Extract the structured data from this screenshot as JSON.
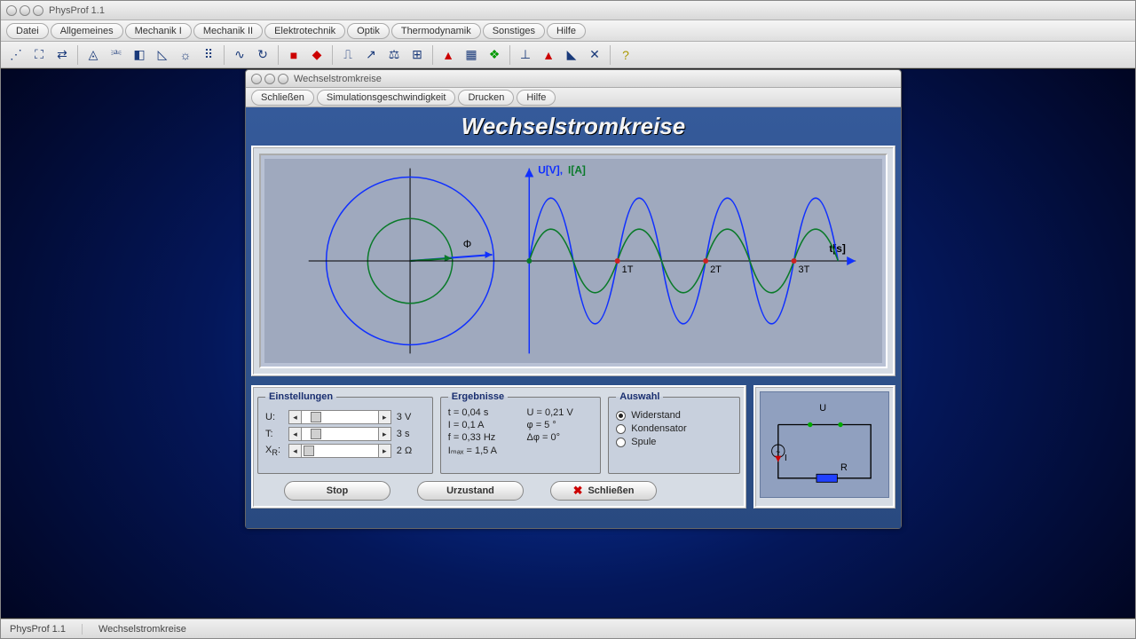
{
  "app": {
    "title": "PhysProf 1.1"
  },
  "menu": [
    "Datei",
    "Allgemeines",
    "Mechanik I",
    "Mechanik II",
    "Elektrotechnik",
    "Optik",
    "Thermodynamik",
    "Sonstiges",
    "Hilfe"
  ],
  "status": {
    "app": "PhysProf 1.1",
    "doc": "Wechselstromkreise"
  },
  "subw": {
    "title": "Wechselstromkreise",
    "menu": [
      "Schließen",
      "Simulationsgeschwindigkeit",
      "Drucken",
      "Hilfe"
    ],
    "heading": "Wechselstromkreise"
  },
  "settings_label": "Einstellungen",
  "settings": {
    "U": {
      "label": "U:",
      "value": "3 V",
      "knob": 12
    },
    "T": {
      "label": "T:",
      "value": "3 s",
      "knob": 12
    },
    "XR": {
      "label": "Xᴿ:",
      "value": "2 Ω",
      "knob": 2
    }
  },
  "results_label": "Ergebnisse",
  "results": {
    "t": "t  = 0,04 s",
    "U": "U  = 0,21 V",
    "I": "I  = 0,1 A",
    "phi": "φ  = 5 °",
    "f": "f  = 0,33 Hz",
    "dphi": "Δφ = 0°",
    "Imax": "Iₘₐₓ  = 1,5 A"
  },
  "selection_label": "Auswahl",
  "selection": {
    "options": [
      "Widerstand",
      "Kondensator",
      "Spule"
    ],
    "selectedIndex": 0
  },
  "buttons": {
    "stop": "Stop",
    "reset": "Urzustand",
    "close": "Schließen"
  },
  "circuit": {
    "U_label": "U",
    "I_label": "I",
    "R_label": "R"
  },
  "chart_data": {
    "type": "line",
    "title": "",
    "xlabel": "t[s]",
    "ylabel": "U[V], I[A]",
    "xlim": [
      0,
      3.5
    ],
    "ylim": [
      -3,
      3
    ],
    "x_ticks": [
      {
        "pos": 1,
        "label": "1T"
      },
      {
        "pos": 2,
        "label": "2T"
      },
      {
        "pos": 3,
        "label": "3T"
      }
    ],
    "phasor_symbol": "Φ",
    "U_amplitude": 3,
    "I_amplitude": 1.5,
    "period_T": 1,
    "phase_deg": 0,
    "series": [
      {
        "name": "U[V]",
        "color": "#0020ff",
        "amplitude": 3,
        "phase_deg": 0,
        "desc": "voltage sine wave, amplitude 3 V, period T"
      },
      {
        "name": "I[A]",
        "color": "#0a7a2a",
        "amplitude": 1.5,
        "phase_deg": 0,
        "desc": "current sine wave, amplitude 1.5 A, in phase with U (resistor)"
      }
    ],
    "notes": "Left side shows two concentric phasor circles (radius r_U=3, r_I=1.5). Red dots at t-axis zero crossings at 1T,2T,3T."
  }
}
